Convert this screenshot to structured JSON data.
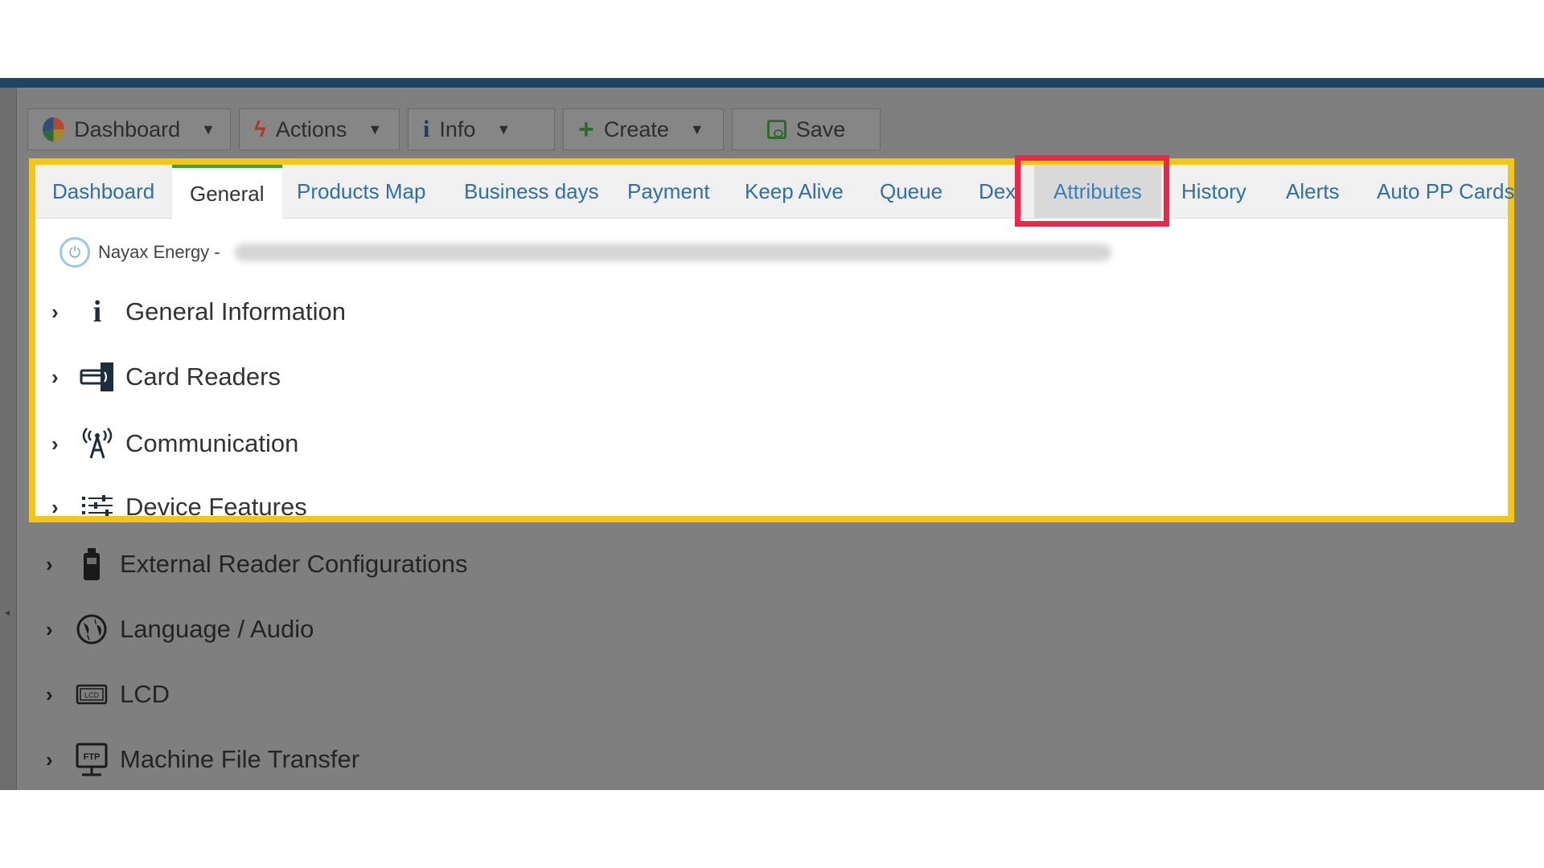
{
  "toolbar": {
    "dashboard_label": "Dashboard",
    "actions_label": "Actions",
    "info_label": "Info",
    "create_label": "Create",
    "save_label": "Save"
  },
  "tabs": [
    {
      "label": "Dashboard"
    },
    {
      "label": "General",
      "active": true
    },
    {
      "label": "Products Map"
    },
    {
      "label": "Business days"
    },
    {
      "label": "Payment"
    },
    {
      "label": "Keep Alive"
    },
    {
      "label": "Queue"
    },
    {
      "label": "Dex"
    },
    {
      "label": "Attributes",
      "highlighted": true
    },
    {
      "label": "History"
    },
    {
      "label": "Alerts"
    },
    {
      "label": "Auto PP Cards"
    }
  ],
  "device": {
    "name": "Nayax Energy -"
  },
  "sections": [
    {
      "label": "General Information",
      "icon": "info-icon"
    },
    {
      "label": "Card Readers",
      "icon": "card-reader-icon"
    },
    {
      "label": "Communication",
      "icon": "antenna-icon"
    },
    {
      "label": "Device Features",
      "icon": "list-settings-icon"
    },
    {
      "label": "External Reader Configurations",
      "icon": "external-reader-icon"
    },
    {
      "label": "Language / Audio",
      "icon": "globe-audio-icon"
    },
    {
      "label": "LCD",
      "icon": "lcd-icon"
    },
    {
      "label": "Machine File Transfer",
      "icon": "ftp-icon"
    }
  ],
  "colors": {
    "highlight_panel": "#f5c518",
    "highlight_tab": "#f0254a",
    "active_tab_accent": "#2ea44f",
    "tab_link": "#2f6fa8"
  }
}
